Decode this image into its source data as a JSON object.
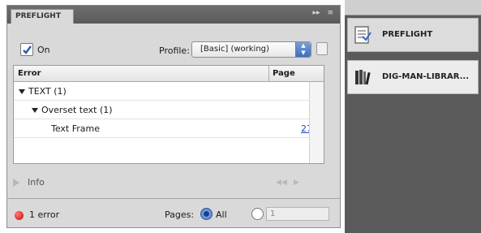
{
  "panel": {
    "tab_title": "PREFLIGHT",
    "on_label": "On",
    "profile_label": "Profile:",
    "profile_value": "[Basic] (working)",
    "columns": {
      "error": "Error",
      "page": "Page"
    },
    "rows": [
      {
        "label": "TEXT (1)"
      },
      {
        "label": "Overset text (1)"
      },
      {
        "label": "Text Frame",
        "page": "27"
      }
    ],
    "info_label": "Info",
    "status": "1 error",
    "pages_label": "Pages:",
    "all_label": "All",
    "range_value": "1"
  },
  "dock": {
    "items": [
      {
        "label": "PREFLIGHT",
        "icon": "preflight-icon"
      },
      {
        "label": "DIG-MAN-LIBRAR...",
        "icon": "library-icon"
      }
    ]
  },
  "colors": {
    "error_dot": "#d10000",
    "link": "#1f49c7",
    "select_accent": "#3d6ebd"
  }
}
